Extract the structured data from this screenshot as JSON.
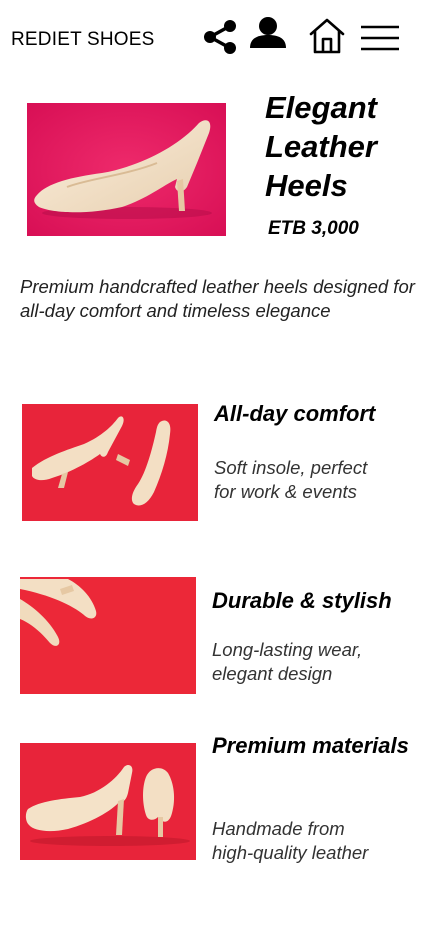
{
  "header": {
    "brand": "REDIET SHOES",
    "icons": [
      "share-icon",
      "user-icon",
      "home-icon",
      "menu-icon"
    ]
  },
  "hero": {
    "image": "cream-patent-leather-heel-on-pink-background",
    "title": "Elegant Leather Heels",
    "price": "ETB 3,000",
    "description": "Premium handcrafted leather heels designed for all-day comfort and timeless elegance"
  },
  "features": [
    {
      "image": "pair-of-cream-heels-top-view-on-red",
      "title": "All-day comfort",
      "description": "Soft insole,  perfect\n for work & events"
    },
    {
      "image": "cream-heels-corner-on-red",
      "title": "Durable & stylish",
      "description": "Long-lasting wear,\n elegant design"
    },
    {
      "image": "cream-heels-side-and-back-view-on-red",
      "title": "Premium materials",
      "description": "Handmade from\nhigh-quality leather"
    }
  ],
  "colors": {
    "text": "#000000",
    "hero_background": "#e8145a",
    "feature_background": "#e8243a",
    "shoe": "#f3dfc4"
  }
}
